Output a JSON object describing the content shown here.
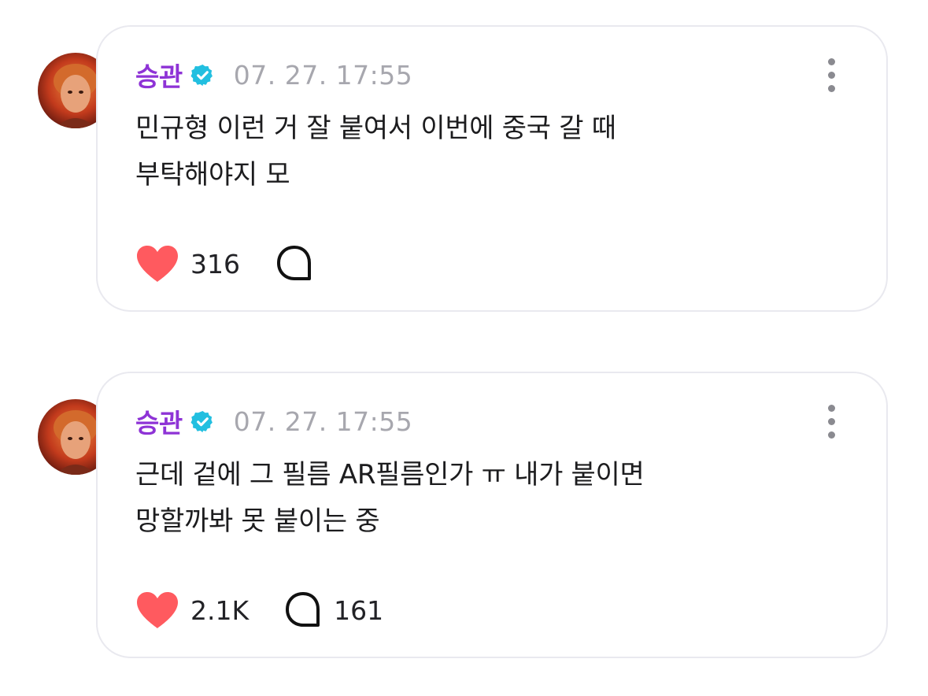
{
  "colors": {
    "name": "#8e33d6",
    "verified_badge": "#22bfe0",
    "heart": "#ff5a5f",
    "timestamp": "#a7a7ae",
    "card_border": "#e9e9ef"
  },
  "posts": [
    {
      "author": "승관",
      "timestamp": "07. 27. 17:55",
      "lines": [
        "민규형 이런 거 잘 붙여서 이번에 중국 갈 때",
        "부탁해야지 모"
      ],
      "likes": "316",
      "comments": "",
      "icons": [
        "verified-badge-icon",
        "more-vertical-icon",
        "heart-icon",
        "comment-bubble-icon"
      ]
    },
    {
      "author": "승관",
      "timestamp": "07. 27. 17:55",
      "lines": [
        "근데 겉에 그 필름 AR필름인가 ㅠ 내가 붙이면",
        "망할까봐 못 붙이는 중"
      ],
      "likes": "2.1K",
      "comments": "161",
      "icons": [
        "verified-badge-icon",
        "more-vertical-icon",
        "heart-icon",
        "comment-bubble-icon"
      ]
    }
  ]
}
